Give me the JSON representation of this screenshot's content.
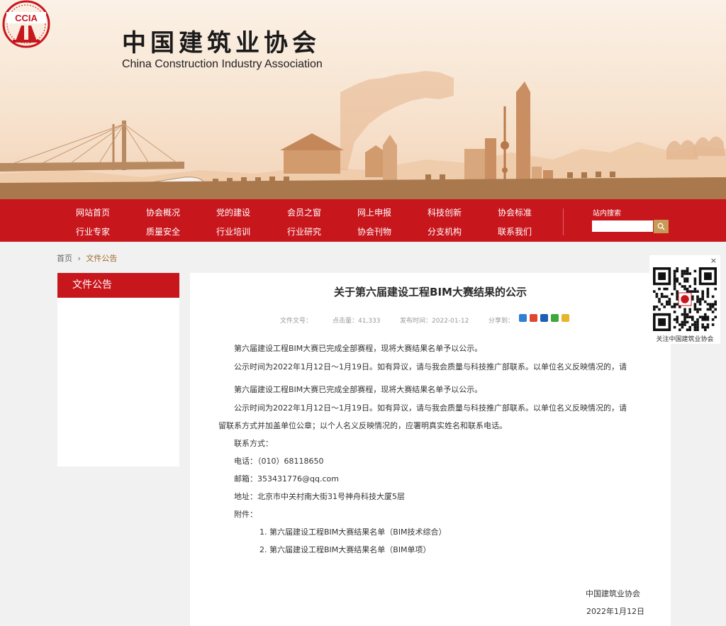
{
  "header": {
    "logo_text": "CCIA",
    "title_cn": "中国建筑业协会",
    "title_en": "China Construction Industry Association"
  },
  "nav": {
    "row1": [
      "网站首页",
      "协会概况",
      "党的建设",
      "会员之窗",
      "网上申报",
      "科技创新",
      "协会标准"
    ],
    "row2": [
      "行业专家",
      "质量安全",
      "行业培训",
      "行业研究",
      "协会刊物",
      "分支机构",
      "联系我们"
    ],
    "search_label": "站内搜索",
    "search_placeholder": ""
  },
  "breadcrumb": {
    "home": "首页",
    "separator": "›",
    "current": "文件公告"
  },
  "sidebar": {
    "title": "文件公告"
  },
  "article": {
    "title": "关于第六届建设工程BIM大赛结果的公示",
    "meta": {
      "doc_no_label": "文件文号：",
      "views_label": "点击量：",
      "views": "41,333",
      "date_label": "发布时间：",
      "date": "2022-01-12",
      "share_label": "分享到："
    },
    "p1": "第六届建设工程BIM大赛已完成全部赛程，现将大赛结果名单予以公示。",
    "p2": "公示时间为2022年1月12日～1月19日。如有异议，请与我会质量与科技推广部联系。以单位名义反映情况的，请",
    "p3": "第六届建设工程BIM大赛已完成全部赛程，现将大赛结果名单予以公示。",
    "p4": "公示时间为2022年1月12日～1月19日。如有异议，请与我会质量与科技推广部联系。以单位名义反映情况的，请",
    "p5": "留联系方式并加盖单位公章；以个人名义反映情况的，应署明真实姓名和联系电话。",
    "contact_label": "联系方式：",
    "phone": "电话：（010）68118650",
    "email": "邮箱：353431776@qq.com",
    "address": "地址：北京市中关村南大街31号神舟科技大厦5层",
    "attachment_label": "附件：",
    "attachments": [
      "1. 第六届建设工程BIM大赛结果名单（BIM技术综合）",
      "2. 第六届建设工程BIM大赛结果名单（BIM单项）"
    ],
    "signature_org": "中国建筑业协会",
    "signature_date": "2022年1月12日"
  },
  "qr": {
    "close": "×",
    "caption": "关注中国建筑业协会"
  },
  "colors": {
    "brand_red": "#c8161d",
    "accent_gold": "#c79a56"
  }
}
